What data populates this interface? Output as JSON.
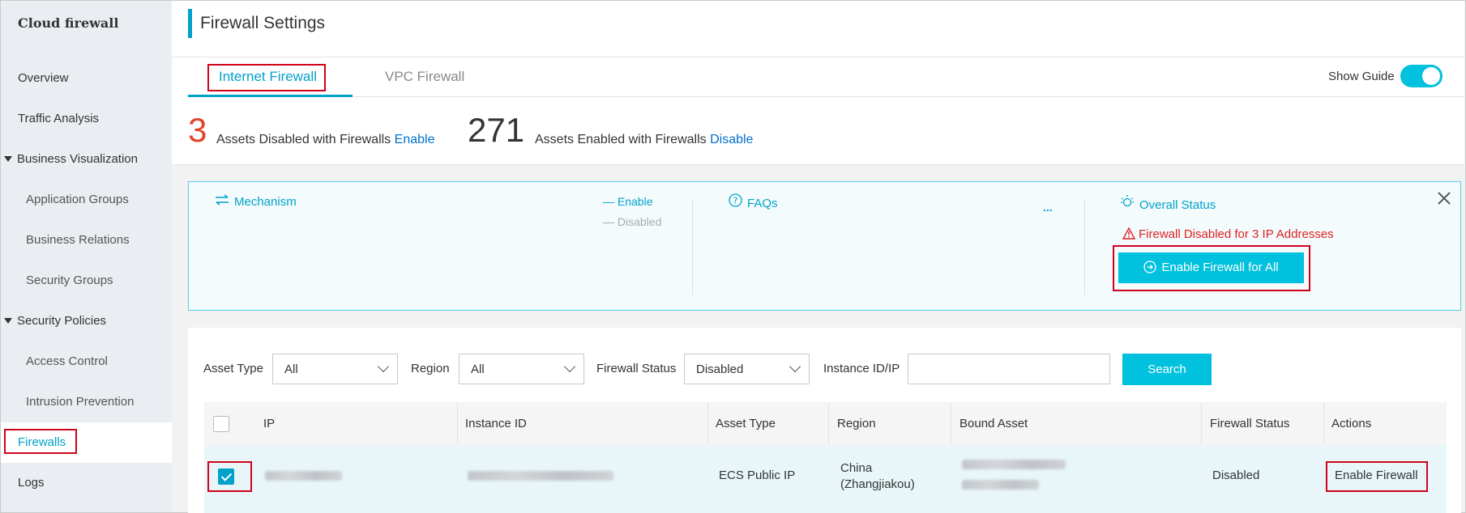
{
  "sidebar": {
    "brand": "Cloud firewall",
    "items": [
      {
        "label": "Overview"
      },
      {
        "label": "Traffic Analysis"
      },
      {
        "label": "Business Visualization"
      },
      {
        "label": "Application Groups"
      },
      {
        "label": "Business Relations"
      },
      {
        "label": "Security Groups"
      },
      {
        "label": "Security Policies"
      },
      {
        "label": "Access Control"
      },
      {
        "label": "Intrusion Prevention"
      },
      {
        "label": "Firewalls"
      },
      {
        "label": "Logs"
      }
    ],
    "active_item": "Firewalls"
  },
  "header": {
    "title": "Firewall Settings"
  },
  "tabs": {
    "items": [
      {
        "label": "Internet Firewall"
      },
      {
        "label": "VPC Firewall"
      }
    ],
    "active": "Internet Firewall",
    "show_guide_label": "Show Guide",
    "show_guide_on": true
  },
  "stats": {
    "disabled_count": "3",
    "disabled_text": "Assets Disabled with Firewalls",
    "disabled_action": "Enable",
    "enabled_count": "271",
    "enabled_text": "Assets Enabled with Firewalls",
    "enabled_action": "Disable"
  },
  "guide": {
    "mechanism_title": "Mechanism",
    "legend_enable": "— Enable",
    "legend_disabled": "— Disabled",
    "faqs_title": "FAQs",
    "faqs_more": "...",
    "overall_title": "Overall Status",
    "warning": "Firewall Disabled for 3 IP Addresses",
    "enable_all_button": "Enable Firewall for All"
  },
  "filters": {
    "asset_type_label": "Asset Type",
    "asset_type_value": "All",
    "region_label": "Region",
    "region_value": "All",
    "status_label": "Firewall Status",
    "status_value": "Disabled",
    "instance_label": "Instance ID/IP",
    "instance_value": "",
    "search_button": "Search"
  },
  "table": {
    "columns": [
      "IP",
      "Instance ID",
      "Asset Type",
      "Region",
      "Bound Asset",
      "Firewall Status",
      "Actions"
    ],
    "rows": [
      {
        "checked": true,
        "asset_type": "ECS Public IP",
        "region_line1": "China",
        "region_line2": "(Zhangjiakou)",
        "firewall_status": "Disabled",
        "action": "Enable Firewall"
      }
    ]
  },
  "colors": {
    "accent": "#00a2ca",
    "button": "#00c1de",
    "danger": "#e02020",
    "highlight_box": "#d0021b"
  }
}
